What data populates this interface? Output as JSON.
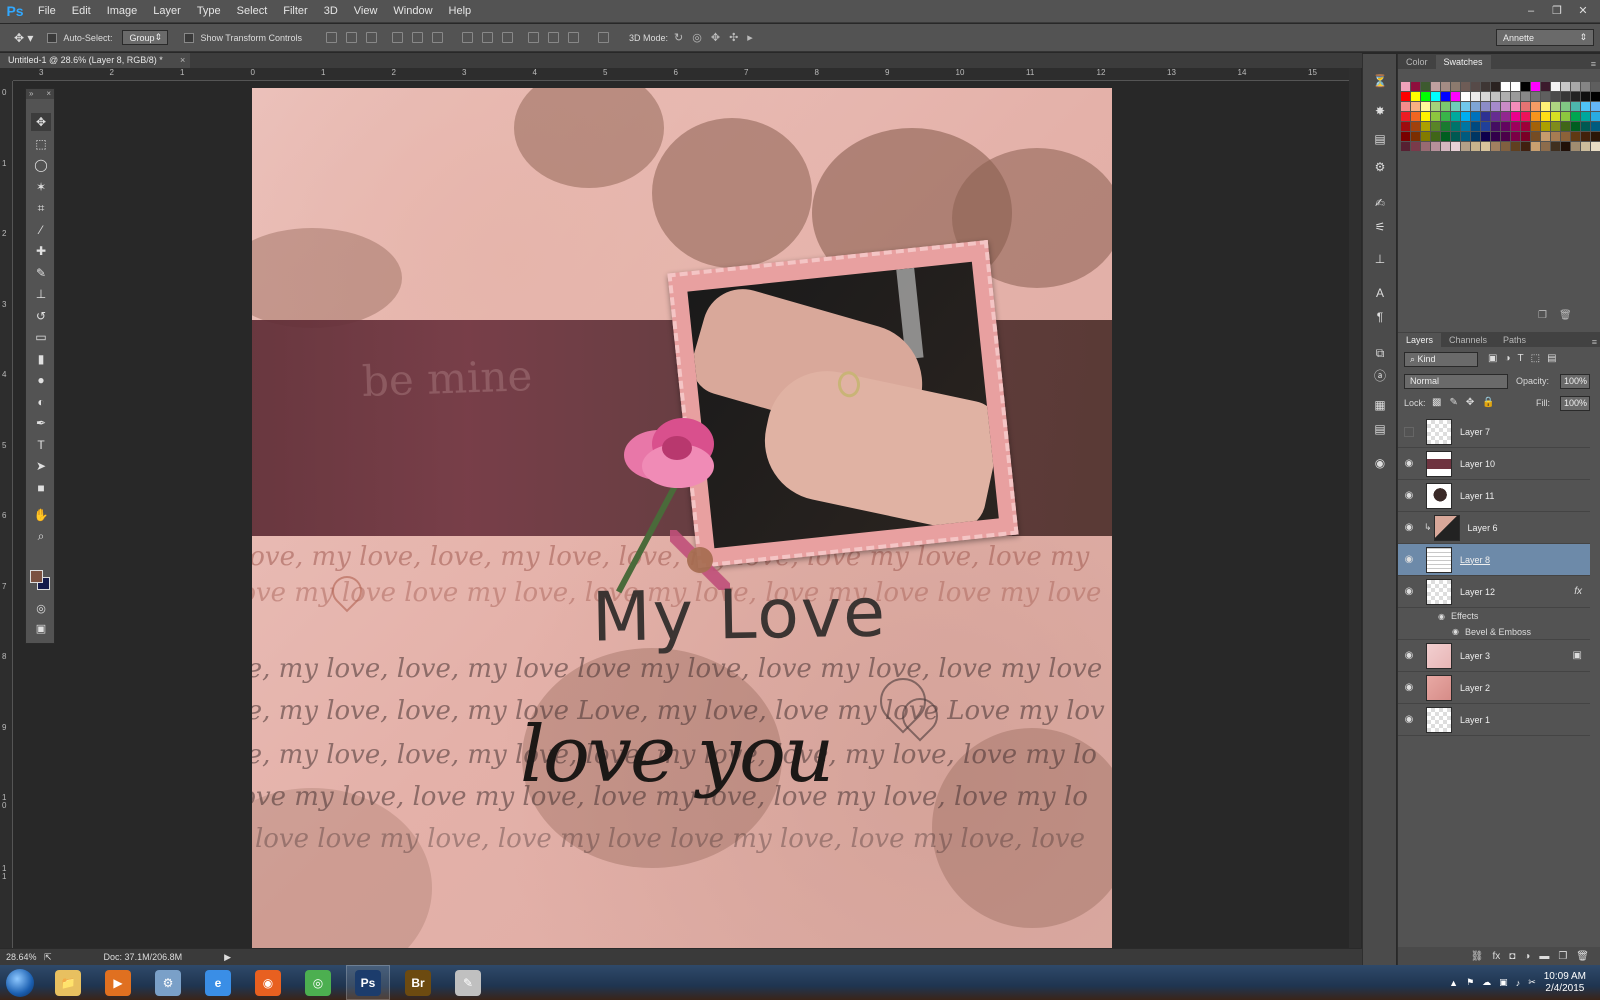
{
  "app": {
    "logo": "Ps",
    "menu": [
      "File",
      "Edit",
      "Image",
      "Layer",
      "Type",
      "Select",
      "Filter",
      "3D",
      "View",
      "Window",
      "Help"
    ],
    "window_controls": [
      "–",
      "❐",
      "✕"
    ]
  },
  "options_bar": {
    "auto_select_label": "Auto-Select:",
    "auto_select_value": "Group",
    "show_transform_label": "Show Transform Controls",
    "mode_3d_label": "3D Mode:",
    "workspace": "Annette"
  },
  "document": {
    "tab_title": "Untitled-1 @ 28.6% (Layer 8, RGB/8) *",
    "tab_close": "×",
    "ruler_top": [
      "3",
      "2",
      "1",
      "0",
      "1",
      "2",
      "3",
      "4",
      "5",
      "6",
      "7",
      "8",
      "9",
      "10",
      "11",
      "12",
      "13",
      "14",
      "15"
    ],
    "ruler_left": [
      "0",
      "1",
      "2",
      "3",
      "4",
      "5",
      "6",
      "7",
      "8",
      "9",
      "1\n0",
      "1\n1"
    ],
    "artwork": {
      "band_text": "be mine",
      "title_mylove": "My Love",
      "title_loveyou": "love you",
      "script_lines": [
        "Love, my love, love, my love, love, my love, love my love, love my",
        "love my love love my love, love my love, love my love love my love",
        "ve, my love, love, my love love my love, love my love, love my love",
        "ve, my love, love, my love Love, my love, love my love Love my lov",
        "ve, my love, love, my love, love, my love, love, my love, love my lo",
        "love my love, love my love, love my love, love my love, love my lo",
        "y love love my love, love my love love my love, love my love, love"
      ]
    }
  },
  "status": {
    "zoom": "28.64%",
    "doc_size": "Doc: 37.1M/206.8M",
    "arrow": "▶"
  },
  "toolbox": {
    "header_left": "»",
    "header_right": "×",
    "tools": [
      {
        "name": "move-tool",
        "glyph": "✥",
        "active": true
      },
      {
        "name": "marquee-tool",
        "glyph": "⬚"
      },
      {
        "name": "lasso-tool",
        "glyph": "◯"
      },
      {
        "name": "magic-wand-tool",
        "glyph": "✶"
      },
      {
        "name": "crop-tool",
        "glyph": "⌗"
      },
      {
        "name": "eyedropper-tool",
        "glyph": "⁄"
      },
      {
        "name": "healing-brush-tool",
        "glyph": "✚"
      },
      {
        "name": "brush-tool",
        "glyph": "✎"
      },
      {
        "name": "clone-stamp-tool",
        "glyph": "⊥"
      },
      {
        "name": "history-brush-tool",
        "glyph": "↺"
      },
      {
        "name": "eraser-tool",
        "glyph": "▭"
      },
      {
        "name": "gradient-tool",
        "glyph": "▮"
      },
      {
        "name": "blur-tool",
        "glyph": "●"
      },
      {
        "name": "dodge-tool",
        "glyph": "◐"
      },
      {
        "name": "pen-tool",
        "glyph": "✒"
      },
      {
        "name": "type-tool",
        "glyph": "T"
      },
      {
        "name": "path-selection-tool",
        "glyph": "➤"
      },
      {
        "name": "rectangle-tool",
        "glyph": "■"
      },
      {
        "name": "hand-tool",
        "glyph": "✋"
      },
      {
        "name": "zoom-tool",
        "glyph": "⌕"
      }
    ],
    "foreground_color": "#7b5140",
    "background_color": "#141b4a",
    "bottom": [
      {
        "name": "quick-mask-button",
        "glyph": "◎"
      },
      {
        "name": "screen-mode-button",
        "glyph": "▣"
      }
    ]
  },
  "side_icons": [
    {
      "name": "history-panel-icon",
      "glyph": "⏳"
    },
    {
      "name": "actions-panel-icon",
      "glyph": "✸"
    },
    {
      "name": "adjustments-panel-icon",
      "glyph": "▤"
    },
    {
      "name": "properties-panel-icon",
      "glyph": "⚙"
    },
    {
      "name": "brush-presets-icon",
      "glyph": "✍"
    },
    {
      "name": "brush-panel-icon",
      "glyph": "⚟"
    },
    {
      "name": "clone-source-icon",
      "glyph": "⊥"
    },
    {
      "name": "character-panel-icon",
      "glyph": "A"
    },
    {
      "name": "paragraph-panel-icon",
      "glyph": "¶"
    },
    {
      "name": "layer-comps-icon",
      "glyph": "⧉"
    },
    {
      "name": "styles-panel-icon",
      "glyph": "ⓐ"
    },
    {
      "name": "info-panel-icon",
      "glyph": "▦"
    },
    {
      "name": "notes-panel-icon",
      "glyph": "▤"
    },
    {
      "name": "3d-panel-icon",
      "glyph": "◉"
    }
  ],
  "color_panel": {
    "tabs": [
      "Color",
      "Swatches"
    ],
    "active_tab": "Swatches",
    "swatches": [
      "#f0a3bb",
      "#8f0f3d",
      "#3d5a2f",
      "#c0a0a0",
      "#a48c84",
      "#8c7a6e",
      "#6e5c56",
      "#564a48",
      "#3e3634",
      "#2a2220",
      "#ffffff",
      "#ffffff",
      "#000000",
      "#ff00ff",
      "#3c1a2c",
      "#f3f3f3",
      "#c9c9c9",
      "#a9a9a9",
      "#858585",
      "#5e5e5e",
      "#ff0000",
      "#ffff00",
      "#00ff00",
      "#00ffff",
      "#0000ff",
      "#ff00ff",
      "#ffffff",
      "#ebebeb",
      "#d7d7d7",
      "#c3c3c3",
      "#afafaf",
      "#9b9b9b",
      "#878787",
      "#737373",
      "#5f5f5f",
      "#4b4b4b",
      "#373737",
      "#232323",
      "#0f0f0f",
      "#000000",
      "#f48c8c",
      "#f8b082",
      "#fff799",
      "#a4d27a",
      "#7bc96f",
      "#6ecdb9",
      "#70c8ec",
      "#7ea5d6",
      "#8c8cc8",
      "#a68acb",
      "#c98bc6",
      "#f38cb9",
      "#e57373",
      "#f59c65",
      "#fff176",
      "#aed581",
      "#81c784",
      "#4db6ac",
      "#4fc3f7",
      "#64b5f6",
      "#ed1c24",
      "#f26522",
      "#fff200",
      "#8dc63f",
      "#39b54a",
      "#00a99d",
      "#00aeef",
      "#0072bc",
      "#2e3192",
      "#662d91",
      "#92278f",
      "#ec008c",
      "#ed145b",
      "#f7941d",
      "#ffde17",
      "#d7df23",
      "#8cc63f",
      "#00a651",
      "#00a79d",
      "#29abe2",
      "#9e0b0f",
      "#a0410d",
      "#aba000",
      "#598527",
      "#1a7b30",
      "#00746b",
      "#0076a3",
      "#004a80",
      "#21409a",
      "#440e62",
      "#630460",
      "#9e005d",
      "#9e0039",
      "#a36209",
      "#aba000",
      "#7f8c1b",
      "#406618",
      "#005e20",
      "#005952",
      "#005b7f",
      "#790000",
      "#7b2e00",
      "#827b00",
      "#406618",
      "#005e20",
      "#005952",
      "#005b7f",
      "#003663",
      "#0d004c",
      "#32004b",
      "#4b0049",
      "#7b0046",
      "#7a0026",
      "#754c24",
      "#c69c6d",
      "#a67c52",
      "#8c6239",
      "#603913",
      "#42210b",
      "#2b1607",
      "#562032",
      "#7a3a4a",
      "#986a72",
      "#b6909a",
      "#d4b6c0",
      "#e8d0d6",
      "#b2a088",
      "#c8b48c",
      "#d8c49c",
      "#a08060",
      "#806040",
      "#604020",
      "#402010",
      "#c8a070",
      "#8c6c4c",
      "#403020",
      "#201008",
      "#a08c70",
      "#ccbc9c",
      "#e8dcc4"
    ]
  },
  "layers_panel": {
    "tabs": [
      "Layers",
      "Channels",
      "Paths"
    ],
    "active_tab": "Layers",
    "filter_kind": "Kind",
    "blend_mode": "Normal",
    "opacity_label": "Opacity:",
    "opacity_value": "100%",
    "lock_label": "Lock:",
    "fill_label": "Fill:",
    "fill_value": "100%",
    "layers": [
      {
        "name": "Layer 7",
        "visible": false,
        "selected": false,
        "thumb": "checker"
      },
      {
        "name": "Layer 10",
        "visible": true,
        "selected": false,
        "thumb": "band"
      },
      {
        "name": "Layer 11",
        "visible": true,
        "selected": false,
        "thumb": "rose"
      },
      {
        "name": "Layer 6",
        "visible": true,
        "selected": false,
        "thumb": "photo",
        "clipped": true
      },
      {
        "name": "Layer 8",
        "visible": true,
        "selected": true,
        "thumb": "text"
      },
      {
        "name": "Layer 12",
        "visible": true,
        "selected": false,
        "thumb": "checker",
        "fx": "fx"
      },
      {
        "name": "Layer 3",
        "visible": true,
        "selected": false,
        "thumb": "pink"
      },
      {
        "name": "Layer 2",
        "visible": true,
        "selected": false,
        "thumb": "pink2"
      },
      {
        "name": "Layer 1",
        "visible": true,
        "selected": false,
        "thumb": "checker"
      }
    ],
    "effects_label": "Effects",
    "effect_item": "Bevel & Emboss",
    "footer_icons": [
      "⛓",
      "fx",
      "◘",
      "◑",
      "▬",
      "❐",
      "🗑"
    ]
  },
  "taskbar": {
    "apps": [
      {
        "name": "explorer-app",
        "label": "📁",
        "color": "#e8c060"
      },
      {
        "name": "media-player-app",
        "label": "▶",
        "color": "#e07020"
      },
      {
        "name": "steam-app",
        "label": "⚙",
        "color": "#7aa0c8"
      },
      {
        "name": "ie-app",
        "label": "e",
        "color": "#3a8ee6"
      },
      {
        "name": "firefox-app",
        "label": "◉",
        "color": "#e86020"
      },
      {
        "name": "chrome-app",
        "label": "◎",
        "color": "#4caf50"
      },
      {
        "name": "photoshop-app",
        "label": "Ps",
        "color": "#1c3c6c",
        "active": true
      },
      {
        "name": "bridge-app",
        "label": "Br",
        "color": "#6c4a10"
      },
      {
        "name": "paint-app",
        "label": "✎",
        "color": "#c0c0c0"
      }
    ],
    "tray": {
      "time": "10:09 AM",
      "date": "2/4/2015",
      "icons": [
        "▲",
        "⚑",
        "☁",
        "▣",
        "♪",
        "✂"
      ]
    }
  }
}
